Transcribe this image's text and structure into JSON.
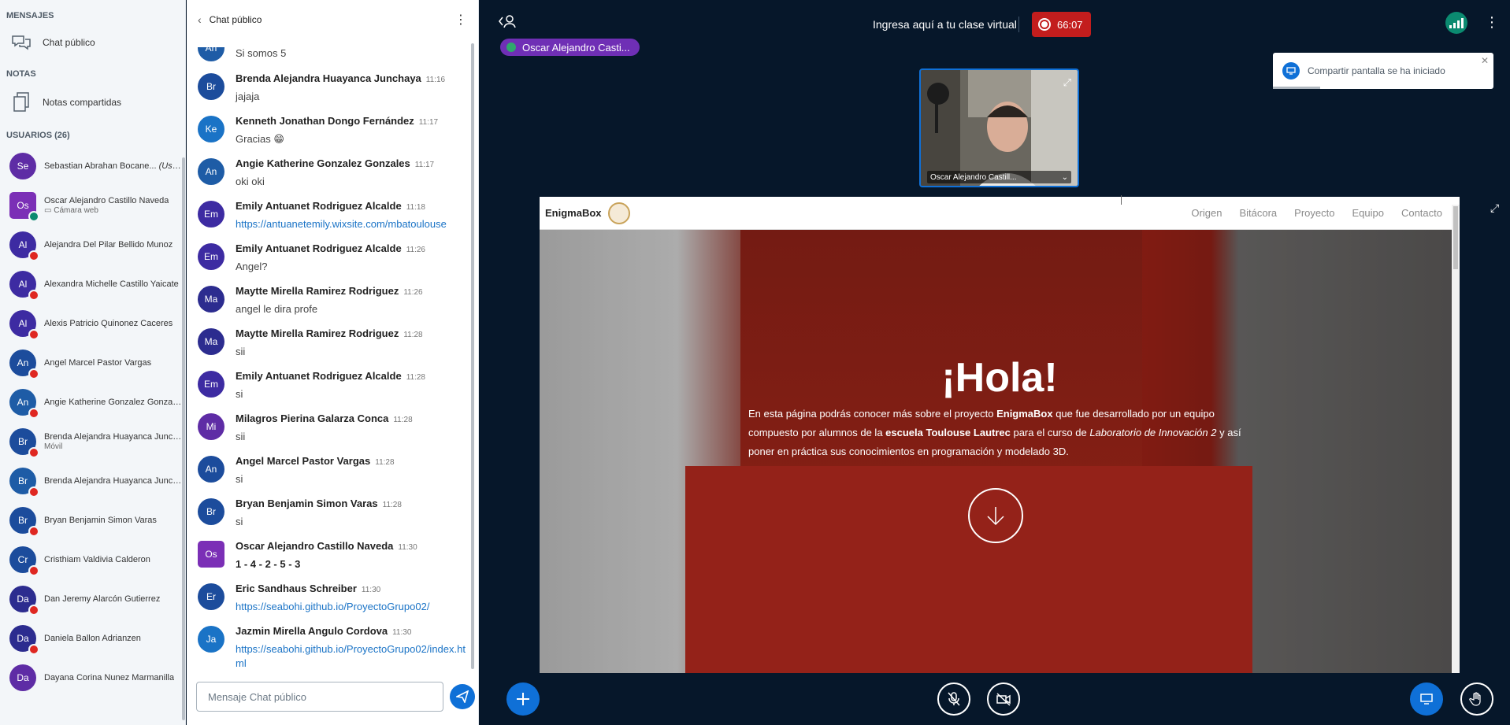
{
  "sidebar": {
    "messages_title": "MENSAJES",
    "public_chat_label": "Chat público",
    "notes_title": "NOTAS",
    "shared_notes_label": "Notas compartidas",
    "users_title": "USUARIOS (26)",
    "users": [
      {
        "initials": "Se",
        "name": "Sebastian Abrahan Bocane...",
        "suffix": "(Usted)",
        "sub": "",
        "color": "#5e2ca5",
        "muted": false,
        "square": false
      },
      {
        "initials": "Os",
        "name": "Oscar Alejandro Castillo Naveda",
        "suffix": "",
        "sub": "▭ Cámara web",
        "color": "#7b2fb6",
        "muted": false,
        "square": true
      },
      {
        "initials": "Al",
        "name": "Alejandra Del Pilar Bellido Munoz",
        "suffix": "",
        "sub": "",
        "color": "#3d2ba2",
        "muted": true,
        "square": false
      },
      {
        "initials": "Al",
        "name": "Alexandra Michelle Castillo Yaicate",
        "suffix": "",
        "sub": "",
        "color": "#3d2ba2",
        "muted": true,
        "square": false
      },
      {
        "initials": "Al",
        "name": "Alexis Patricio Quinonez Caceres",
        "suffix": "",
        "sub": "",
        "color": "#3d2ba2",
        "muted": true,
        "square": false
      },
      {
        "initials": "An",
        "name": "Angel Marcel Pastor Vargas",
        "suffix": "",
        "sub": "",
        "color": "#1c4c9c",
        "muted": true,
        "square": false
      },
      {
        "initials": "An",
        "name": "Angie Katherine Gonzalez Gonzales",
        "suffix": "",
        "sub": "",
        "color": "#1e5ca6",
        "muted": true,
        "square": false
      },
      {
        "initials": "Br",
        "name": "Brenda Alejandra Huayanca Junch...",
        "suffix": "",
        "sub": "Móvil",
        "color": "#1c4c9c",
        "muted": true,
        "square": false
      },
      {
        "initials": "Br",
        "name": "Brenda Alejandra Huayanca Junch...",
        "suffix": "",
        "sub": "",
        "color": "#1e5ca6",
        "muted": true,
        "square": false
      },
      {
        "initials": "Br",
        "name": "Bryan Benjamin Simon Varas",
        "suffix": "",
        "sub": "",
        "color": "#1c4c9c",
        "muted": true,
        "square": false
      },
      {
        "initials": "Cr",
        "name": "Cristhiam Valdivia Calderon",
        "suffix": "",
        "sub": "",
        "color": "#1c4c9c",
        "muted": true,
        "square": false
      },
      {
        "initials": "Da",
        "name": "Dan Jeremy Alarcón Gutierrez",
        "suffix": "",
        "sub": "",
        "color": "#2c2c8f",
        "muted": true,
        "square": false
      },
      {
        "initials": "Da",
        "name": "Daniela Ballon Adrianzen",
        "suffix": "",
        "sub": "",
        "color": "#2c2c8f",
        "muted": true,
        "square": false
      },
      {
        "initials": "Da",
        "name": "Dayana Corina Nunez Marmanilla",
        "suffix": "",
        "sub": "",
        "color": "#5e2ca5",
        "muted": false,
        "square": false
      }
    ]
  },
  "chat": {
    "title": "Chat público",
    "input_placeholder": "Mensaje Chat público",
    "messages": [
      {
        "initials": "An",
        "name": "",
        "time": "",
        "text": "Si somos 5",
        "type": "",
        "color": "#1e5ca6",
        "partial": true
      },
      {
        "initials": "Br",
        "name": "Brenda Alejandra Huayanca Junchaya",
        "time": "11:16",
        "text": "jajaja",
        "type": "",
        "color": "#1c4c9c"
      },
      {
        "initials": "Ke",
        "name": "Kenneth Jonathan Dongo Fernández",
        "time": "11:17",
        "text": "Gracias 😁",
        "type": "",
        "color": "#1a73c6"
      },
      {
        "initials": "An",
        "name": "Angie Katherine Gonzalez Gonzales",
        "time": "11:17",
        "text": "oki oki",
        "type": "",
        "color": "#1e5ca6"
      },
      {
        "initials": "Em",
        "name": "Emily Antuanet Rodriguez Alcalde",
        "time": "11:18",
        "text": "https://antuanetemily.wixsite.com/mbatoulouse",
        "type": "link",
        "color": "#3d2ba2"
      },
      {
        "initials": "Em",
        "name": "Emily Antuanet Rodriguez Alcalde",
        "time": "11:26",
        "text": "Angel?",
        "type": "",
        "color": "#3d2ba2"
      },
      {
        "initials": "Ma",
        "name": "Maytte Mirella Ramirez Rodriguez",
        "time": "11:26",
        "text": "angel le dira profe",
        "type": "",
        "color": "#2c2c8f"
      },
      {
        "initials": "Ma",
        "name": "Maytte Mirella Ramirez Rodriguez",
        "time": "11:28",
        "text": "sii",
        "type": "",
        "color": "#2c2c8f"
      },
      {
        "initials": "Em",
        "name": "Emily Antuanet Rodriguez Alcalde",
        "time": "11:28",
        "text": "si",
        "type": "",
        "color": "#3d2ba2"
      },
      {
        "initials": "Mi",
        "name": "Milagros Pierina Galarza Conca",
        "time": "11:28",
        "text": "sii",
        "type": "",
        "color": "#5e2ca5"
      },
      {
        "initials": "An",
        "name": "Angel Marcel Pastor Vargas",
        "time": "11:28",
        "text": "si",
        "type": "",
        "color": "#1c4c9c"
      },
      {
        "initials": "Br",
        "name": "Bryan Benjamin Simon Varas",
        "time": "11:28",
        "text": "si",
        "type": "",
        "color": "#1c4c9c"
      },
      {
        "initials": "Os",
        "name": "Oscar Alejandro Castillo Naveda",
        "time": "11:30",
        "text": "1 - 4 - 2 - 5 - 3",
        "type": "bold",
        "color": "#7b2fb6",
        "square": true
      },
      {
        "initials": "Er",
        "name": "Eric Sandhaus Schreiber",
        "time": "11:30",
        "text": "https://seabohi.github.io/ProyectoGrupo02/",
        "type": "link",
        "color": "#1c4c9c"
      },
      {
        "initials": "Ja",
        "name": "Jazmin Mirella Angulo Cordova",
        "time": "11:30",
        "text": "https://seabohi.github.io/ProyectoGrupo02/index.html",
        "type": "link",
        "color": "#1a73c6"
      }
    ]
  },
  "topbar": {
    "title": "Ingresa aquí a tu clase virtual",
    "recording_time": "66:07",
    "talker": "Oscar Alejandro Casti...",
    "toast": "Compartir pantalla se ha iniciado"
  },
  "webcam": {
    "name": "Oscar Alejandro Castill..."
  },
  "screenshare": {
    "logo": "EnigmaBox",
    "nav": [
      "Origen",
      "Bitácora",
      "Proyecto",
      "Equipo",
      "Contacto"
    ],
    "headline": "¡Hola!",
    "p1": "En esta página podrás conocer más sobre el proyecto ",
    "b1": "EnigmaBox",
    "p2": " que fue desarrollado por un equipo compuesto por alumnos de la ",
    "b2": "escuela Toulouse Lautrec",
    "p3": " para el curso de ",
    "i1": "Laboratorio de Innovación 2",
    "p4": " y así poner en práctica sus conocimientos en programación y modelado 3D."
  },
  "colors": {
    "accent": "#0f70d7",
    "recording": "#c31d1d",
    "muted": "#df2721",
    "background": "#06172a"
  }
}
